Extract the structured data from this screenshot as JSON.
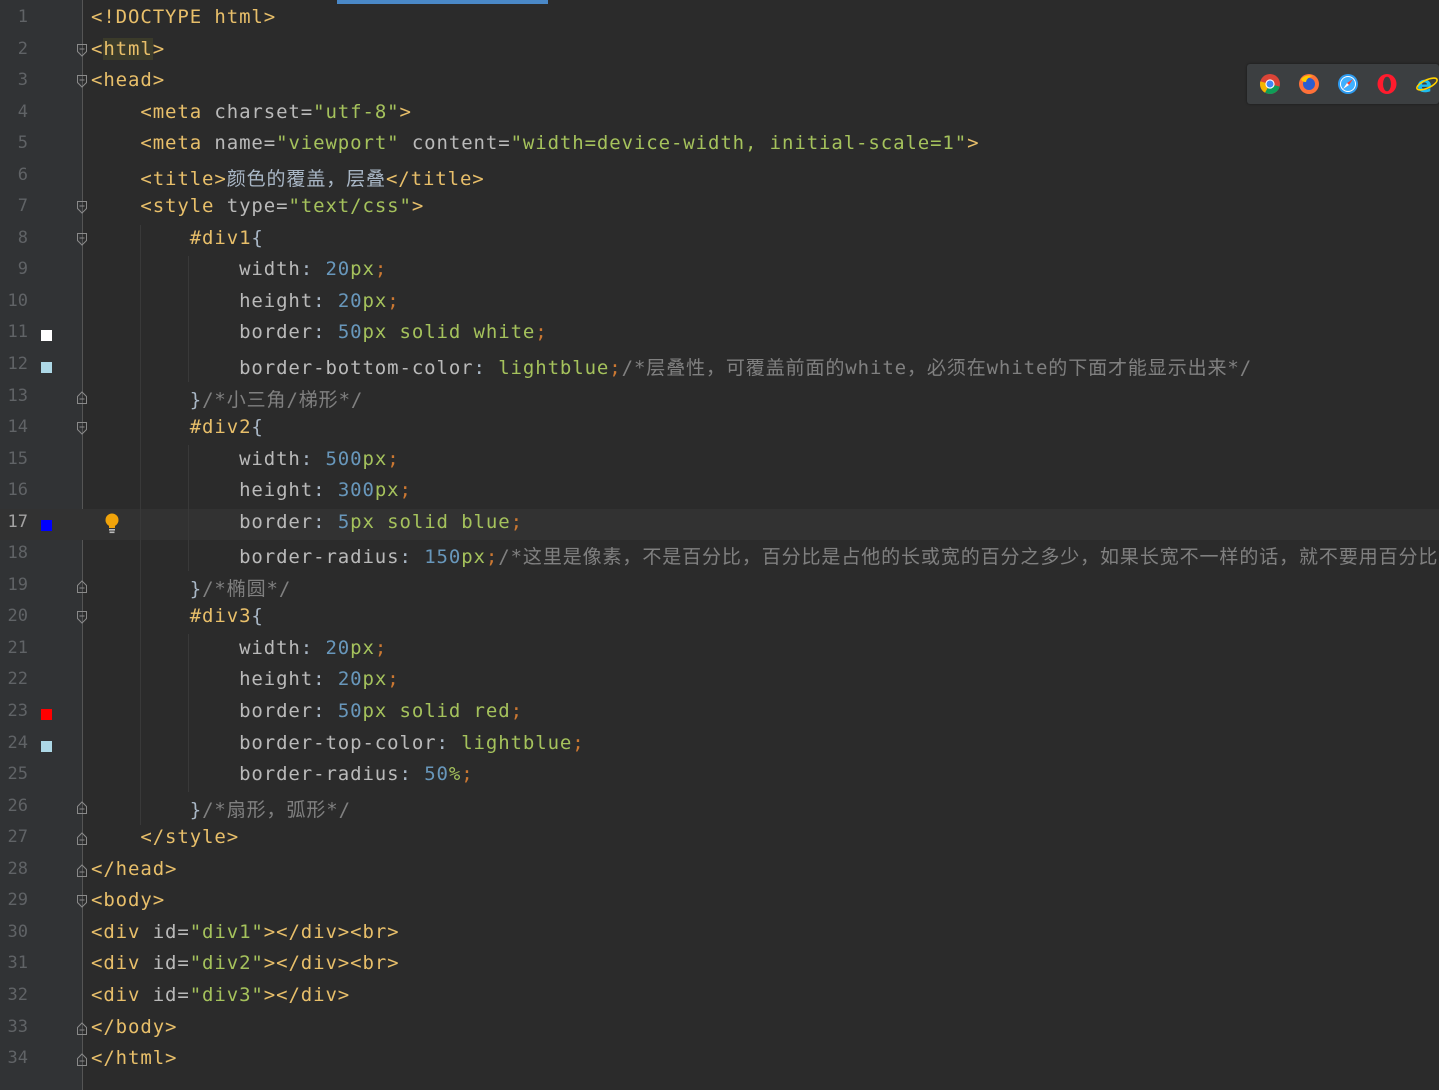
{
  "editor": {
    "current_line": 17,
    "lines": [
      {
        "n": "1"
      },
      {
        "n": "2"
      },
      {
        "n": "3"
      },
      {
        "n": "4"
      },
      {
        "n": "5"
      },
      {
        "n": "6"
      },
      {
        "n": "7"
      },
      {
        "n": "8"
      },
      {
        "n": "9"
      },
      {
        "n": "10"
      },
      {
        "n": "11"
      },
      {
        "n": "12"
      },
      {
        "n": "13"
      },
      {
        "n": "14"
      },
      {
        "n": "15"
      },
      {
        "n": "16"
      },
      {
        "n": "17"
      },
      {
        "n": "18"
      },
      {
        "n": "19"
      },
      {
        "n": "20"
      },
      {
        "n": "21"
      },
      {
        "n": "22"
      },
      {
        "n": "23"
      },
      {
        "n": "24"
      },
      {
        "n": "25"
      },
      {
        "n": "26"
      },
      {
        "n": "27"
      },
      {
        "n": "28"
      },
      {
        "n": "29"
      },
      {
        "n": "30"
      },
      {
        "n": "31"
      },
      {
        "n": "32"
      },
      {
        "n": "33"
      },
      {
        "n": "34"
      }
    ],
    "code": {
      "l1": [
        "<!DOCTYPE html>"
      ],
      "l2": [
        "<",
        "html",
        ">"
      ],
      "l3": [
        "<head>"
      ],
      "l4": [
        "<meta",
        " charset=",
        "\"utf-8\"",
        ">"
      ],
      "l5": [
        "<meta",
        " name=",
        "\"viewport\"",
        " content=",
        "\"width=device-width, initial-scale=1\"",
        ">"
      ],
      "l6": [
        "<title>",
        "颜色的覆盖，层叠",
        "</title>"
      ],
      "l7": [
        "<style",
        " type=",
        "\"text/css\"",
        ">"
      ],
      "l8": [
        "#div1",
        "{"
      ],
      "l9": [
        "width",
        ": ",
        "20",
        "px",
        ";"
      ],
      "l10": [
        "height",
        ": ",
        "20",
        "px",
        ";"
      ],
      "l11": [
        "border",
        ": ",
        "50",
        "px",
        " solid white",
        ";"
      ],
      "l12": [
        "border-bottom-color",
        ": ",
        "lightblue",
        ";",
        "/*层叠性，可覆盖前面的white，必须在white的下面才能显示出来*/"
      ],
      "l13": [
        "}",
        "/*小三角/梯形*/"
      ],
      "l14": [
        "#div2",
        "{"
      ],
      "l15": [
        "width",
        ": ",
        "500",
        "px",
        ";"
      ],
      "l16": [
        "height",
        ": ",
        "300",
        "px",
        ";"
      ],
      "l17": [
        "border",
        ": ",
        "5",
        "px",
        " solid blue",
        ";"
      ],
      "l18": [
        "border-radius",
        ": ",
        "150",
        "px",
        ";",
        "/*这里是像素，不是百分比，百分比是占他的长或宽的百分之多少，如果长宽不一样的话，就不要用百分比*/"
      ],
      "l19": [
        "}",
        "/*椭圆*/"
      ],
      "l20": [
        "#div3",
        "{"
      ],
      "l21": [
        "width",
        ": ",
        "20",
        "px",
        ";"
      ],
      "l22": [
        "height",
        ": ",
        "20",
        "px",
        ";"
      ],
      "l23": [
        "border",
        ": ",
        "50",
        "px",
        " solid red",
        ";"
      ],
      "l24": [
        "border-top-color",
        ": ",
        "lightblue",
        ";"
      ],
      "l25": [
        "border-radius",
        ": ",
        "50",
        "%",
        ";"
      ],
      "l26": [
        "}",
        "/*扇形，弧形*/"
      ],
      "l27": [
        "</style>"
      ],
      "l28": [
        "</head>"
      ],
      "l29": [
        "<body>"
      ],
      "l30": [
        "<div",
        " id=",
        "\"div1\"",
        "></div><br>"
      ],
      "l31": [
        "<div",
        " id=",
        "\"div2\"",
        "></div><br>"
      ],
      "l32": [
        "<div",
        " id=",
        "\"div3\"",
        "></div>"
      ],
      "l33": [
        "</body>"
      ],
      "l34": [
        "</html>"
      ]
    }
  },
  "swatches": {
    "l11": "#ffffff",
    "l12": "#add8e6",
    "l17": "#0000ff",
    "l23": "#ff0000",
    "l24": "#add8e6"
  },
  "browser_bar": {
    "icons": [
      "chrome-icon",
      "firefox-icon",
      "safari-icon",
      "opera-icon",
      "ie-icon"
    ]
  }
}
